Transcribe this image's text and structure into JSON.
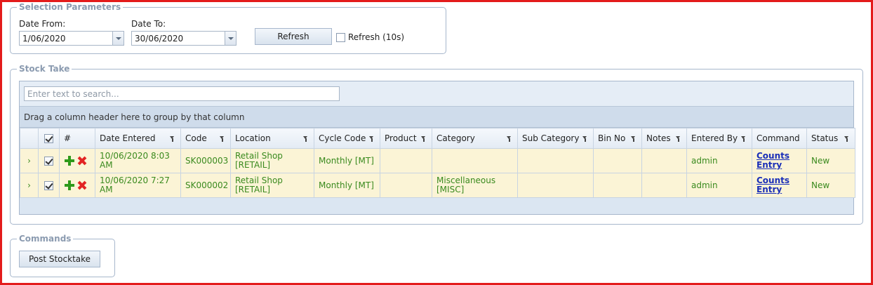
{
  "selection": {
    "legend": "Selection Parameters",
    "date_from_label": "Date From:",
    "date_from_value": "1/06/2020",
    "date_to_label": "Date To:",
    "date_to_value": "30/06/2020",
    "refresh_label": "Refresh",
    "auto_refresh_label": "Refresh (10s)",
    "auto_refresh_checked": false
  },
  "stock_take": {
    "legend": "Stock Take",
    "search_placeholder": "Enter text to search...",
    "group_hint": "Drag a column header here to group by that column",
    "columns": {
      "hash": "#",
      "date_entered": "Date Entered",
      "code": "Code",
      "location": "Location",
      "cycle_code": "Cycle Code",
      "product": "Product",
      "category": "Category",
      "sub_category": "Sub Category",
      "bin_no": "Bin No",
      "notes": "Notes",
      "entered_by": "Entered By",
      "command": "Command",
      "status": "Status"
    },
    "rows": [
      {
        "date_entered": "10/06/2020 8:03 AM",
        "code": "SK000003",
        "location": "Retail Shop [RETAIL]",
        "cycle_code": "Monthly [MT]",
        "product": "",
        "category": "",
        "sub_category": "",
        "bin_no": "",
        "notes": "",
        "entered_by": "admin",
        "command": "Counts Entry",
        "status": "New"
      },
      {
        "date_entered": "10/06/2020 7:27 AM",
        "code": "SK000002",
        "location": "Retail Shop [RETAIL]",
        "cycle_code": "Monthly [MT]",
        "product": "",
        "category": "Miscellaneous [MISC]",
        "sub_category": "",
        "bin_no": "",
        "notes": "",
        "entered_by": "admin",
        "command": "Counts Entry",
        "status": "New"
      }
    ]
  },
  "commands": {
    "legend": "Commands",
    "post_label": "Post Stocktake"
  },
  "icons": {
    "expand": "chevron-right-icon",
    "add": "plus-icon",
    "delete": "delete-icon",
    "filter": "filter-icon"
  },
  "colors": {
    "frame_border": "#e31b1b",
    "row_background": "#fbf4d6",
    "row_text": "#3a8a1e",
    "link": "#1a2fb8",
    "legend": "#8b9bb0"
  }
}
